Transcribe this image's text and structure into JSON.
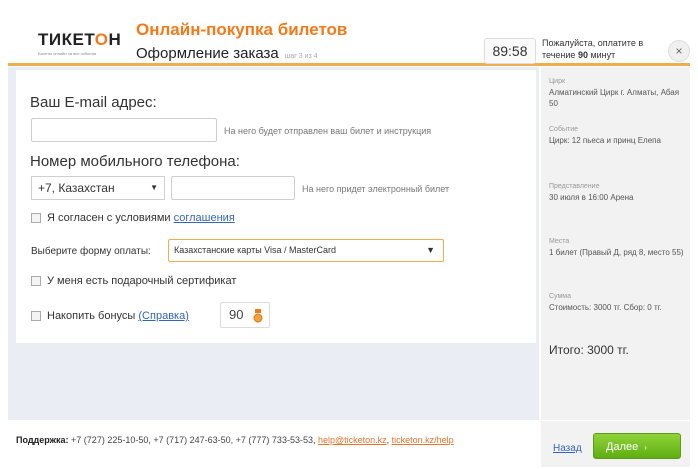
{
  "header": {
    "logo_main": "ТИКЕТ",
    "logo_o": "О",
    "logo_end": "Н",
    "logo_sub": "Билеты онлайн на все события",
    "title": "Онлайн-покупка билетов",
    "subtitle": "Оформление заказа",
    "step": "шаг 3 из 4",
    "timer": "89:58",
    "pay_note_prefix": "Пожалуйста, оплатите в течение ",
    "pay_note_minutes": "90",
    "pay_note_suffix": " минут",
    "close_icon": "×"
  },
  "form": {
    "email_label": "Ваш E-mail адрес:",
    "email_value": "",
    "email_hint": "На него будет отправлен ваш билет и инструкция",
    "phone_label": "Номер мобильного телефона:",
    "phone_country": "+7, Казахстан",
    "phone_value": "",
    "phone_hint": "На него придет электронный билет",
    "agree_text": "Я согласен с условиями ",
    "agree_link": "соглашения",
    "payment_label": "Выберите форму оплаты:",
    "payment_value": "Казахстанские карты Visa / MasterCard",
    "gift_text": "У меня есть подарочный сертификат",
    "bonus_text": "Накопить бонусы ",
    "bonus_link": "(Справка)",
    "bonus_value": "90"
  },
  "summary": {
    "circus_label": "Цирк",
    "circus_value": "Алматинский Цирк г. Алматы, Абая 50",
    "event_label": "Событие",
    "event_value": "Цирк: 12 пьеса и принц Елепа",
    "show_label": "Представление",
    "show_value": "30 июля в 16:00 Арена",
    "seats_label": "Места",
    "seats_value": "1 билет (Правый Д, ряд 8, место 55)",
    "sum_label": "Сумма",
    "sum_value": "Стоимость: 3000 тг. Сбор: 0 тг.",
    "total": "Итого: 3000 тг."
  },
  "footer": {
    "support_label": "Поддержка:",
    "support_phones": " +7 (727) 225-10-50, +7 (717) 247-63-50, +7 (777) 733-53-53, ",
    "support_email": "help@ticketon.kz",
    "support_sep": ", ",
    "support_url": "ticketon.kz/help",
    "back_label": "Назад",
    "next_label": "Далее"
  },
  "colors": {
    "accent": "#f27a1a",
    "next_button": "#6cbf1c",
    "link": "#3366bb"
  },
  "icons": {
    "close": "close-icon",
    "dropdown": "chevron-down-icon",
    "bonus": "medal-icon",
    "next": "chevron-right-icon"
  }
}
